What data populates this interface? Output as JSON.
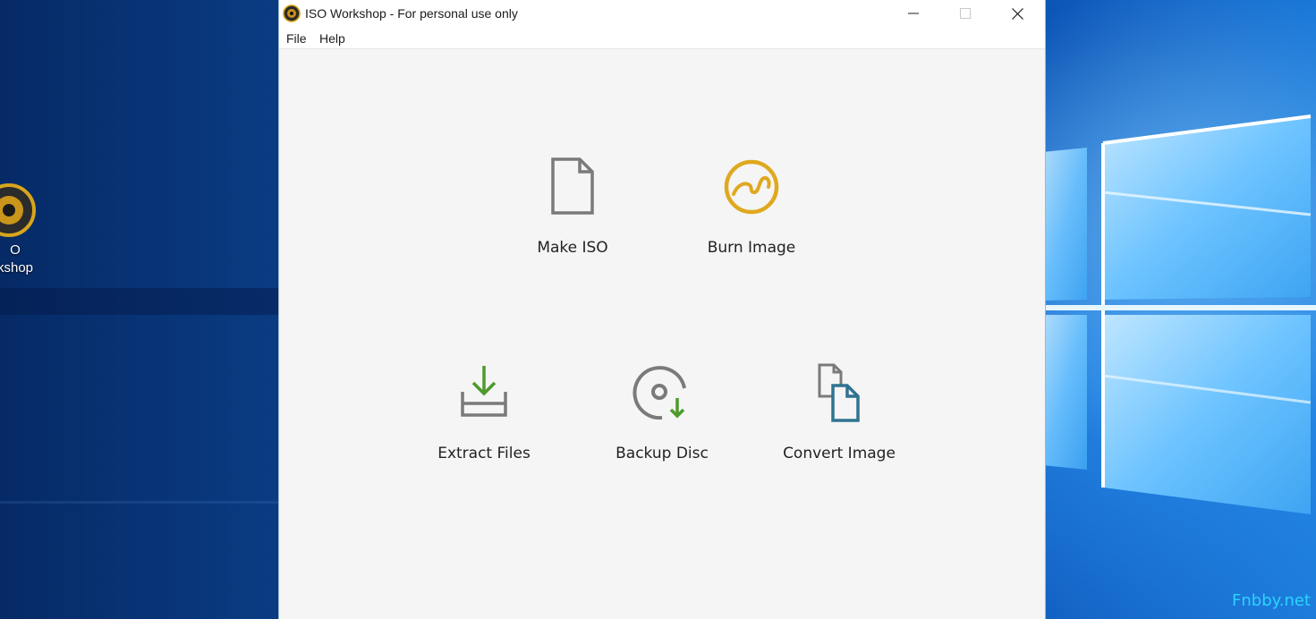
{
  "window": {
    "title": "ISO Workshop - For personal use only",
    "controls": {
      "minimize": "minimize",
      "maximize": "maximize",
      "close": "close"
    }
  },
  "menu": {
    "file": "File",
    "help": "Help"
  },
  "actions": {
    "make_iso": "Make ISO",
    "burn_image": "Burn Image",
    "extract_files": "Extract Files",
    "backup_disc": "Backup Disc",
    "convert_image": "Convert Image"
  },
  "desktop": {
    "icon_label_line1": "O",
    "icon_label_line2": "kshop",
    "watermark": "Fnbby.net"
  },
  "colors": {
    "icon_gray": "#7a7a7a",
    "accent_gold": "#e0a820",
    "accent_green": "#4e9a2c",
    "accent_teal": "#2f7391"
  },
  "icons": [
    "file-icon",
    "disc-burn-icon",
    "extract-tray-icon",
    "disc-backup-icon",
    "convert-document-icon"
  ]
}
